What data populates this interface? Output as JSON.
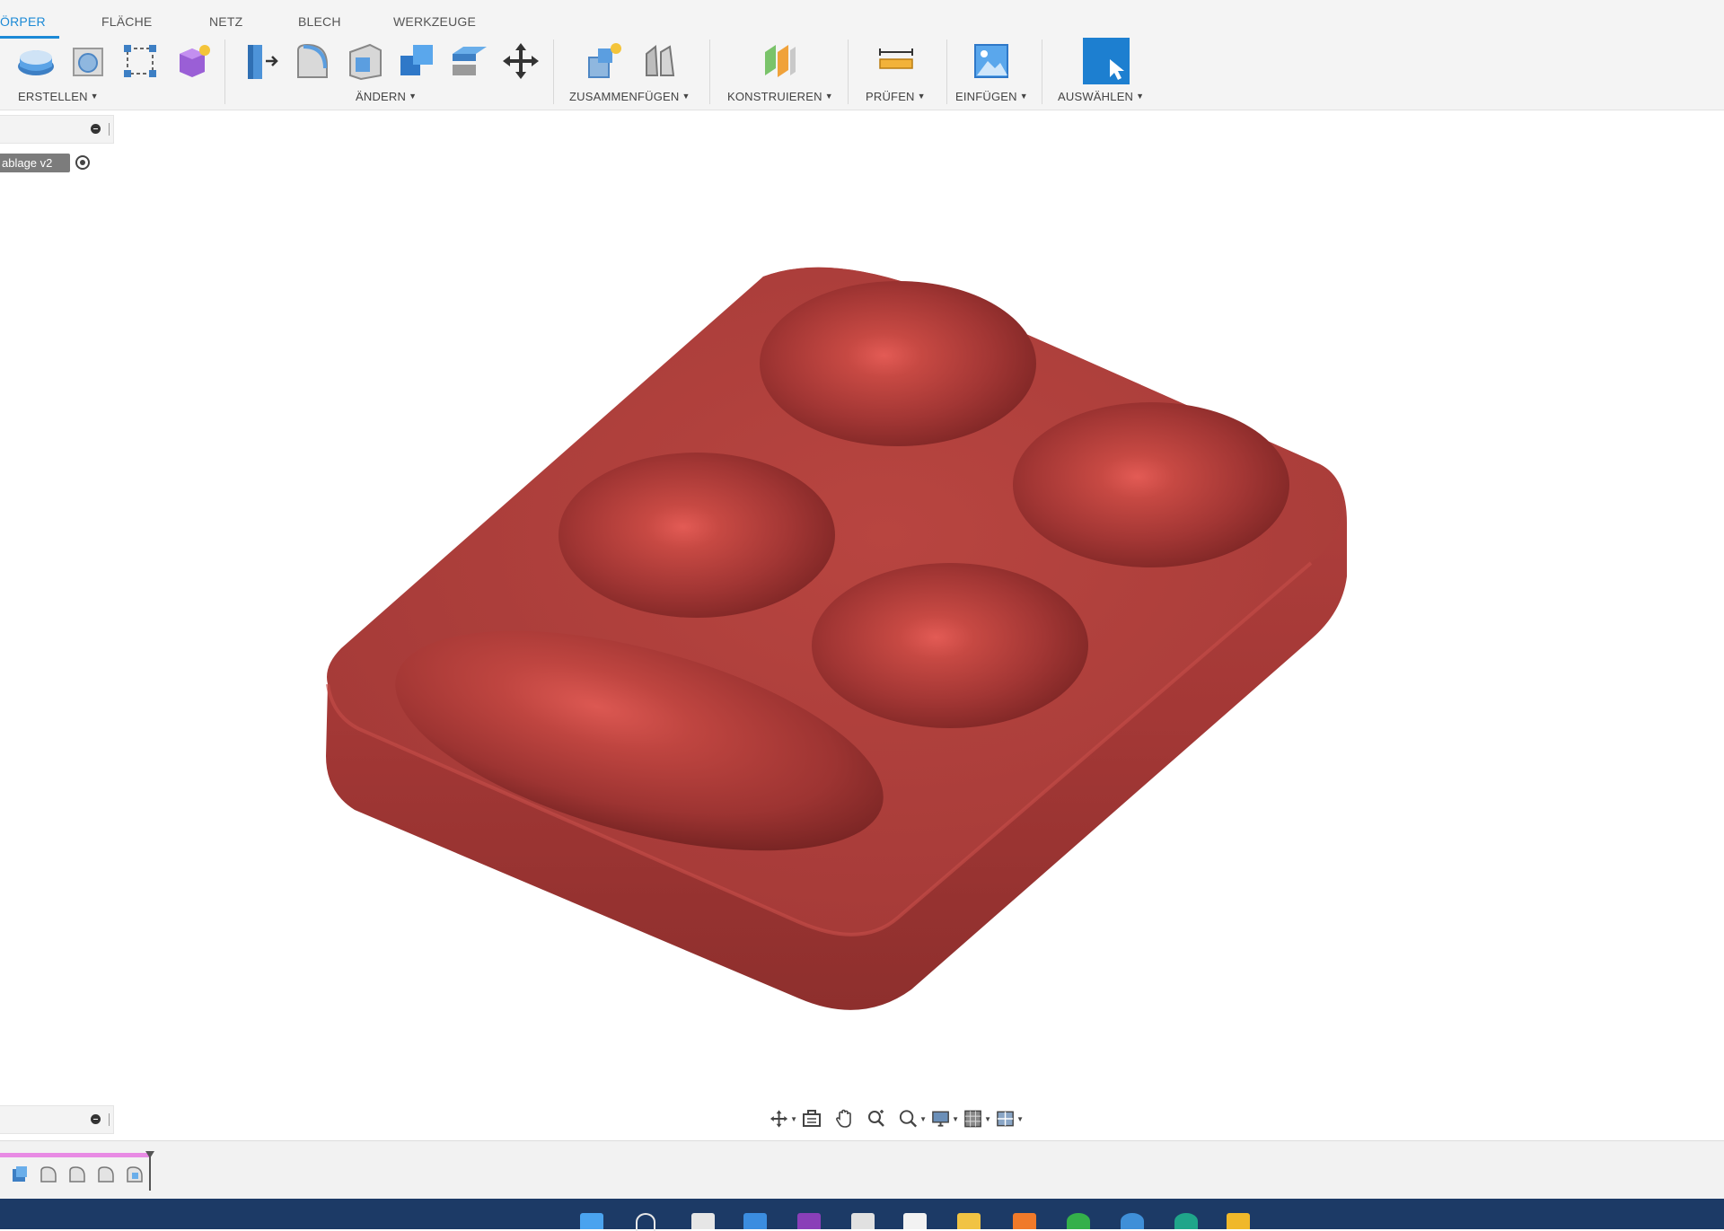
{
  "toolbar": {
    "tabs": [
      {
        "label": "ÖRPER",
        "active": true
      },
      {
        "label": "FLÄCHE",
        "active": false
      },
      {
        "label": "NETZ",
        "active": false
      },
      {
        "label": "BLECH",
        "active": false
      },
      {
        "label": "WERKZEUGE",
        "active": false
      }
    ],
    "groups": [
      {
        "label": "ERSTELLEN"
      },
      {
        "label": "ÄNDERN"
      },
      {
        "label": "ZUSAMMENFÜGEN"
      },
      {
        "label": "KONSTRUIEREN"
      },
      {
        "label": "PRÜFEN"
      },
      {
        "label": "EINFÜGEN"
      },
      {
        "label": "AUSWÄHLEN"
      }
    ],
    "caret": "▼",
    "accent_color": "#1c8ad6"
  },
  "browser": {
    "document_name": "ablage v2"
  },
  "icons": {
    "create": [
      "extrude-icon",
      "revolve-icon",
      "sketch-icon",
      "form-icon"
    ],
    "modify": [
      "press-pull-icon",
      "fillet-icon",
      "shell-icon",
      "combine-icon",
      "offset-face-icon",
      "move-icon"
    ],
    "assemble": [
      "new-component-icon",
      "joint-icon"
    ],
    "construct": [
      "offset-plane-icon"
    ],
    "inspect": [
      "measure-icon"
    ],
    "insert": [
      "insert-image-icon"
    ],
    "select": [
      "select-icon"
    ]
  },
  "model": {
    "color": "#a63c3a",
    "description_hidden": true
  },
  "navbar": {
    "buttons": [
      "orbit-icon",
      "look-at-icon",
      "pan-icon",
      "zoom-icon",
      "fit-icon",
      "display-settings-icon",
      "grid-icon",
      "viewports-icon"
    ]
  },
  "timeline": {
    "feature_count": 5,
    "bar_color": "#e88be4"
  },
  "taskbar": {
    "color": "#1c3a66"
  }
}
